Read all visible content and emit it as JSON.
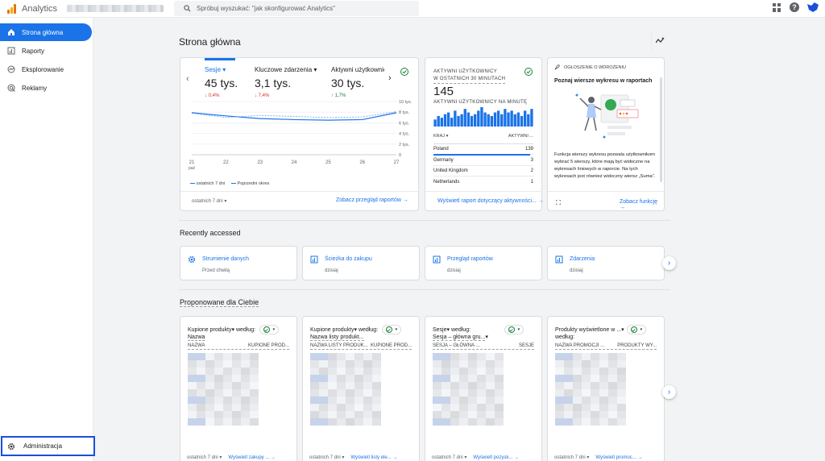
{
  "app": {
    "title": "Analytics"
  },
  "search": {
    "placeholder": "Spróbuj wyszukać: \"jak skonfigurować Analytics\""
  },
  "sidebar": {
    "items": [
      {
        "label": "Strona główna",
        "icon": "home-icon",
        "active": true
      },
      {
        "label": "Raporty",
        "icon": "reports-icon"
      },
      {
        "label": "Eksplorowanie",
        "icon": "explore-icon"
      },
      {
        "label": "Reklamy",
        "icon": "advertising-icon"
      }
    ],
    "admin_label": "Administracja"
  },
  "page": {
    "title": "Strona główna"
  },
  "metrics_card": {
    "tabs": [
      {
        "label": "Sesje",
        "value": "45 tys.",
        "change": "↓ 0,4%",
        "trend": "down"
      },
      {
        "label": "Kluczowe zdarzenia",
        "value": "3,1 tys.",
        "change": "↓ 7,4%",
        "trend": "down"
      },
      {
        "label": "Aktywni użytkownicy",
        "value": "30 tys.",
        "change": "↑ 1,7%",
        "trend": "up"
      }
    ],
    "y_ticks": [
      "10 tys.",
      "8 tys.",
      "6 tys.",
      "4 tys.",
      "2 tys.",
      "0"
    ],
    "x_ticks": [
      "21",
      "22",
      "23",
      "24",
      "25",
      "26",
      "27"
    ],
    "x_sub": "paź",
    "legend": [
      "ostatnich 7 dni",
      "Poprzedni okres"
    ],
    "range_label": "ostatnich 7 dni",
    "link": "Zobacz przegląd raportów"
  },
  "chart_data": {
    "type": "line",
    "x": [
      "21",
      "22",
      "23",
      "24",
      "25",
      "26",
      "27"
    ],
    "ylim": [
      0,
      10000
    ],
    "series": [
      {
        "name": "ostatnich 7 dni",
        "values": [
          7900,
          7300,
          6800,
          6600,
          6500,
          6600,
          7900
        ]
      },
      {
        "name": "Poprzedni okres",
        "values": [
          7800,
          7000,
          7400,
          7200,
          7000,
          7100,
          8100
        ]
      }
    ]
  },
  "realtime_card": {
    "header_line1": "AKTYWNI UŻYTKOWNICY",
    "header_line2": "W OSTATNICH 30 MINUTACH",
    "value": "145",
    "per_minute_label": "AKTYWNI UŻYTKOWNICY NA MINUTĘ",
    "bars": [
      4,
      6,
      5,
      7,
      8,
      5,
      9,
      6,
      7,
      10,
      8,
      6,
      7,
      9,
      11,
      8,
      7,
      6,
      8,
      9,
      7,
      10,
      8,
      9,
      7,
      8,
      6,
      9,
      7,
      10
    ],
    "col_country": "KRAJ",
    "col_users": "AKTYWNI ...",
    "rows": [
      {
        "country": "Poland",
        "users": "139"
      },
      {
        "country": "Germany",
        "users": "3"
      },
      {
        "country": "United Kingdom",
        "users": "2"
      },
      {
        "country": "Netherlands",
        "users": "1"
      }
    ],
    "link": "Wyświetl raport dotyczący aktywności..."
  },
  "announcement_card": {
    "label": "OGŁOSZENIE O WDROŻENIU",
    "title": "Poznaj wiersze wykresu w raportach",
    "body": "Funkcja wierszy wykresu pozwala użytkownikom wybrać 5 wierszy, które mają być widoczne na wykresach liniowych w raporcie. Na tych wykresach jest również widoczny wiersz „Suma”.",
    "link": "Zobacz funkcję"
  },
  "recent": {
    "title": "Recently accessed",
    "items": [
      {
        "title": "Strumienie danych",
        "sub": "Przed chwilą",
        "icon": "gear-icon"
      },
      {
        "title": "Ścieżka do zakupu",
        "sub": "dzisiaj",
        "icon": "report-icon"
      },
      {
        "title": "Przegląd raportów",
        "sub": "dzisiaj",
        "icon": "report-icon"
      },
      {
        "title": "Zdarzenia",
        "sub": "dzisiaj",
        "icon": "report-icon"
      }
    ]
  },
  "suggested": {
    "title": "Proponowane dla Ciebie",
    "cards": [
      {
        "title_a": "Kupione produkty",
        "title_b": " według:",
        "title_c": "Nazwa",
        "col1": "NAZWA",
        "col2": "KUPIONE PROD...",
        "range": "ostatnich 7 dni",
        "link": "Wyświetl zakupy ..."
      },
      {
        "title_a": "Kupione produkty",
        "title_b": " według:",
        "title_c": "Nazwa listy produkt...",
        "col1": "NAZWA LISTY PRODUK...",
        "col2": "KUPIONE PROD...",
        "range": "ostatnich 7 dni",
        "link": "Wyświetl listy ele..."
      },
      {
        "title_a": "Sesje",
        "title_b": " według:",
        "title_c": "Sesja – główna gru...",
        "col1": "SESJA – GŁÓWNA ...",
        "col2": "SESJE",
        "range": "ostatnich 7 dni",
        "link": "Wyświetl pozysk..."
      },
      {
        "title_a": "Produkty wyświetlone w ...",
        "title_b": "",
        "title_c": "według:",
        "col1": "NAZWA PROMOCJI ...",
        "col2": "PRODUKTY WY...",
        "range": "ostatnich 7 dni",
        "link": "Wyświetl promoc..."
      }
    ]
  },
  "colors": {
    "accent": "#1a73e8",
    "logo_orange": "#e37400",
    "logo_yellow": "#f9ab00",
    "down": "#d93025",
    "up": "#188038"
  }
}
